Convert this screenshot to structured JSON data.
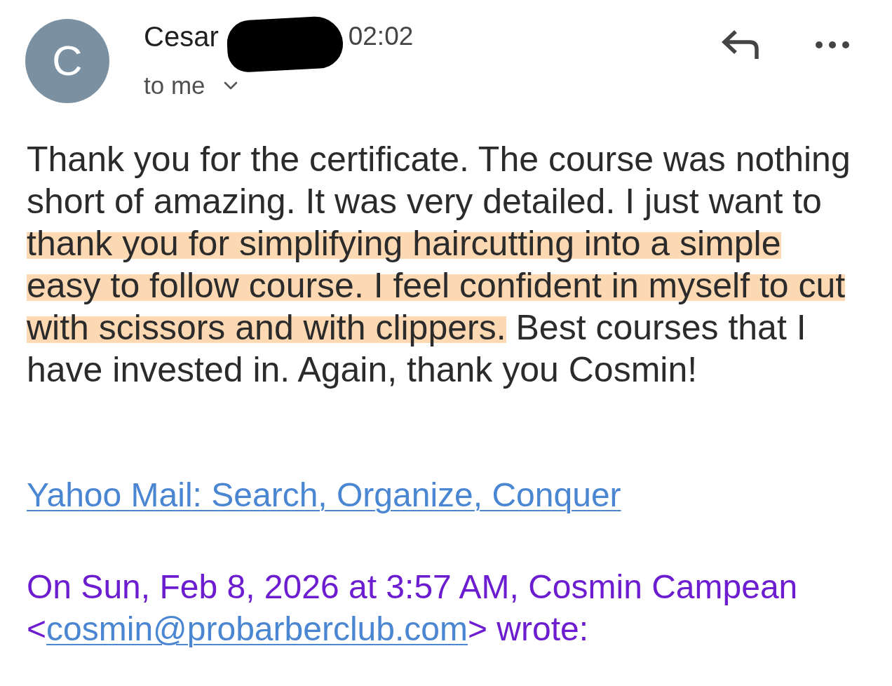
{
  "message": {
    "sender": {
      "avatar_letter": "C",
      "name": "Cesar",
      "redacted": true
    },
    "time": "02:02",
    "recipient": "to me",
    "body": [
      {
        "text": "Thank you for the certificate. The course was nothing short of amazing. It was very detailed. I just want to ",
        "highlighted": false
      },
      {
        "text": "thank you for simplifying haircutting into a simple easy to follow course. I feel confident in myself to cut with scissors and with clippers.",
        "highlighted": true
      },
      {
        "text": " Best courses that I have invested in. Again, thank you Cosmin!",
        "highlighted": false
      }
    ],
    "signature_link": "Yahoo Mail: Search, Organize, Conquer",
    "quote_header": {
      "before": "On Sun, Feb 8, 2026 at 3:57 AM, Cosmin Campean <",
      "email": "cosmin@probarberclub.com",
      "after": "> wrote:"
    }
  }
}
